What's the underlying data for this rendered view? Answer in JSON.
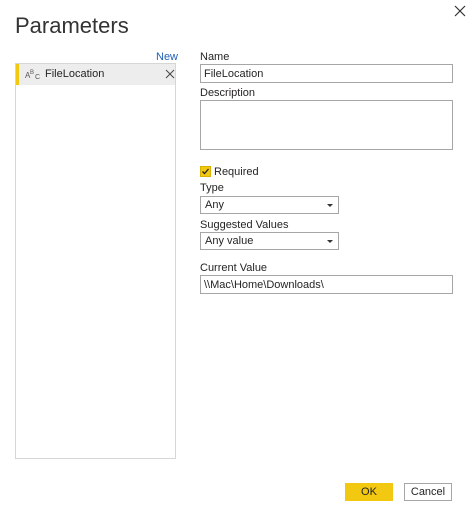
{
  "dialog": {
    "title": "Parameters"
  },
  "list": {
    "new_label": "New",
    "items": [
      {
        "type_icon": "abc-text-type-icon",
        "label": "FileLocation",
        "selected": true
      }
    ]
  },
  "form": {
    "name_label": "Name",
    "name_value": "FileLocation",
    "description_label": "Description",
    "description_value": "",
    "required_label": "Required",
    "required_checked": true,
    "type_label": "Type",
    "type_value": "Any",
    "suggested_label": "Suggested Values",
    "suggested_value": "Any value",
    "current_label": "Current Value",
    "current_value": "\\\\Mac\\Home\\Downloads\\"
  },
  "buttons": {
    "ok_label": "OK",
    "cancel_label": "Cancel"
  },
  "colors": {
    "accent": "#f2c811",
    "link": "#1f5fb4",
    "selected_row": "#ededed",
    "border": "#a6a6a6"
  }
}
